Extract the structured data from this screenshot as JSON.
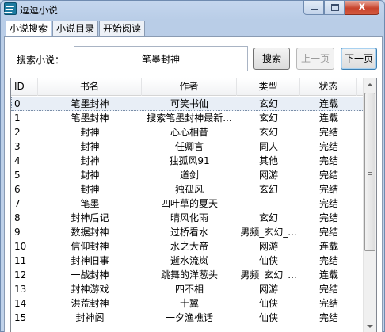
{
  "window": {
    "title": "逗逗小说",
    "close_symbol": "x"
  },
  "tabs": [
    {
      "label": "小说搜索",
      "active": true
    },
    {
      "label": "小说目录",
      "active": false
    },
    {
      "label": "开始阅读",
      "active": false
    }
  ],
  "search": {
    "label": "搜索小说：",
    "value": "笔墨封神",
    "search_button": "搜索",
    "prev_button": "上一页",
    "next_button": "下一页"
  },
  "results": {
    "columns": [
      "ID",
      "书名",
      "作者",
      "类型",
      "状态"
    ],
    "rows": [
      {
        "id": "0",
        "name": "笔墨封神",
        "author": "可笑书仙",
        "type": "玄幻",
        "status": "连载"
      },
      {
        "id": "1",
        "name": "笔墨封神",
        "author": "搜索笔墨封神最新...",
        "type": "玄幻",
        "status": "连载"
      },
      {
        "id": "2",
        "name": "封神",
        "author": "心心相昔",
        "type": "玄幻",
        "status": "完结"
      },
      {
        "id": "3",
        "name": "封神",
        "author": "任卿言",
        "type": "同人",
        "status": "完结"
      },
      {
        "id": "4",
        "name": "封神",
        "author": "独孤风91",
        "type": "其他",
        "status": "完结"
      },
      {
        "id": "5",
        "name": "封神",
        "author": "道剑",
        "type": "网游",
        "status": "完结"
      },
      {
        "id": "6",
        "name": "封神",
        "author": "独孤风",
        "type": "玄幻",
        "status": "完结"
      },
      {
        "id": "7",
        "name": "笔墨",
        "author": "四叶草的夏天",
        "type": "",
        "status": "完结"
      },
      {
        "id": "8",
        "name": "封神后记",
        "author": "晴风化雨",
        "type": "玄幻",
        "status": "完结"
      },
      {
        "id": "9",
        "name": "数据封神",
        "author": "过桥看水",
        "type": "男频_玄幻_...",
        "status": "完结"
      },
      {
        "id": "10",
        "name": "信仰封神",
        "author": "水之大帝",
        "type": "网游",
        "status": "连载"
      },
      {
        "id": "11",
        "name": "封神旧事",
        "author": "逝水流岚",
        "type": "仙侠",
        "status": "完结"
      },
      {
        "id": "12",
        "name": "一战封神",
        "author": "跳舞的洋葱头",
        "type": "男频_玄幻_...",
        "status": "连载"
      },
      {
        "id": "13",
        "name": "封神游戏",
        "author": "四不相",
        "type": "网游",
        "status": "完结"
      },
      {
        "id": "14",
        "name": "洪荒封神",
        "author": "十翼",
        "type": "仙侠",
        "status": "完结"
      },
      {
        "id": "15",
        "name": "封神阁",
        "author": "一夕渔樵话",
        "type": "仙侠",
        "status": "完结"
      }
    ]
  }
}
